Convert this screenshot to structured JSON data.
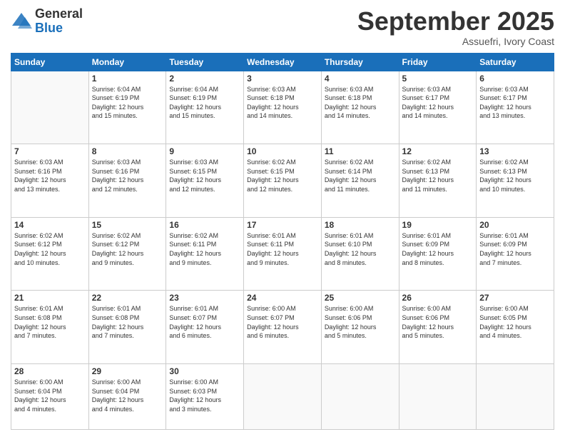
{
  "header": {
    "logo": {
      "general": "General",
      "blue": "Blue"
    },
    "month": "September 2025",
    "location": "Assuefri, Ivory Coast"
  },
  "weekdays": [
    "Sunday",
    "Monday",
    "Tuesday",
    "Wednesday",
    "Thursday",
    "Friday",
    "Saturday"
  ],
  "weeks": [
    [
      {
        "day": "",
        "info": ""
      },
      {
        "day": "1",
        "info": "Sunrise: 6:04 AM\nSunset: 6:19 PM\nDaylight: 12 hours\nand 15 minutes."
      },
      {
        "day": "2",
        "info": "Sunrise: 6:04 AM\nSunset: 6:19 PM\nDaylight: 12 hours\nand 15 minutes."
      },
      {
        "day": "3",
        "info": "Sunrise: 6:03 AM\nSunset: 6:18 PM\nDaylight: 12 hours\nand 14 minutes."
      },
      {
        "day": "4",
        "info": "Sunrise: 6:03 AM\nSunset: 6:18 PM\nDaylight: 12 hours\nand 14 minutes."
      },
      {
        "day": "5",
        "info": "Sunrise: 6:03 AM\nSunset: 6:17 PM\nDaylight: 12 hours\nand 14 minutes."
      },
      {
        "day": "6",
        "info": "Sunrise: 6:03 AM\nSunset: 6:17 PM\nDaylight: 12 hours\nand 13 minutes."
      }
    ],
    [
      {
        "day": "7",
        "info": "Sunrise: 6:03 AM\nSunset: 6:16 PM\nDaylight: 12 hours\nand 13 minutes."
      },
      {
        "day": "8",
        "info": "Sunrise: 6:03 AM\nSunset: 6:16 PM\nDaylight: 12 hours\nand 12 minutes."
      },
      {
        "day": "9",
        "info": "Sunrise: 6:03 AM\nSunset: 6:15 PM\nDaylight: 12 hours\nand 12 minutes."
      },
      {
        "day": "10",
        "info": "Sunrise: 6:02 AM\nSunset: 6:15 PM\nDaylight: 12 hours\nand 12 minutes."
      },
      {
        "day": "11",
        "info": "Sunrise: 6:02 AM\nSunset: 6:14 PM\nDaylight: 12 hours\nand 11 minutes."
      },
      {
        "day": "12",
        "info": "Sunrise: 6:02 AM\nSunset: 6:13 PM\nDaylight: 12 hours\nand 11 minutes."
      },
      {
        "day": "13",
        "info": "Sunrise: 6:02 AM\nSunset: 6:13 PM\nDaylight: 12 hours\nand 10 minutes."
      }
    ],
    [
      {
        "day": "14",
        "info": "Sunrise: 6:02 AM\nSunset: 6:12 PM\nDaylight: 12 hours\nand 10 minutes."
      },
      {
        "day": "15",
        "info": "Sunrise: 6:02 AM\nSunset: 6:12 PM\nDaylight: 12 hours\nand 9 minutes."
      },
      {
        "day": "16",
        "info": "Sunrise: 6:02 AM\nSunset: 6:11 PM\nDaylight: 12 hours\nand 9 minutes."
      },
      {
        "day": "17",
        "info": "Sunrise: 6:01 AM\nSunset: 6:11 PM\nDaylight: 12 hours\nand 9 minutes."
      },
      {
        "day": "18",
        "info": "Sunrise: 6:01 AM\nSunset: 6:10 PM\nDaylight: 12 hours\nand 8 minutes."
      },
      {
        "day": "19",
        "info": "Sunrise: 6:01 AM\nSunset: 6:09 PM\nDaylight: 12 hours\nand 8 minutes."
      },
      {
        "day": "20",
        "info": "Sunrise: 6:01 AM\nSunset: 6:09 PM\nDaylight: 12 hours\nand 7 minutes."
      }
    ],
    [
      {
        "day": "21",
        "info": "Sunrise: 6:01 AM\nSunset: 6:08 PM\nDaylight: 12 hours\nand 7 minutes."
      },
      {
        "day": "22",
        "info": "Sunrise: 6:01 AM\nSunset: 6:08 PM\nDaylight: 12 hours\nand 7 minutes."
      },
      {
        "day": "23",
        "info": "Sunrise: 6:01 AM\nSunset: 6:07 PM\nDaylight: 12 hours\nand 6 minutes."
      },
      {
        "day": "24",
        "info": "Sunrise: 6:00 AM\nSunset: 6:07 PM\nDaylight: 12 hours\nand 6 minutes."
      },
      {
        "day": "25",
        "info": "Sunrise: 6:00 AM\nSunset: 6:06 PM\nDaylight: 12 hours\nand 5 minutes."
      },
      {
        "day": "26",
        "info": "Sunrise: 6:00 AM\nSunset: 6:06 PM\nDaylight: 12 hours\nand 5 minutes."
      },
      {
        "day": "27",
        "info": "Sunrise: 6:00 AM\nSunset: 6:05 PM\nDaylight: 12 hours\nand 4 minutes."
      }
    ],
    [
      {
        "day": "28",
        "info": "Sunrise: 6:00 AM\nSunset: 6:04 PM\nDaylight: 12 hours\nand 4 minutes."
      },
      {
        "day": "29",
        "info": "Sunrise: 6:00 AM\nSunset: 6:04 PM\nDaylight: 12 hours\nand 4 minutes."
      },
      {
        "day": "30",
        "info": "Sunrise: 6:00 AM\nSunset: 6:03 PM\nDaylight: 12 hours\nand 3 minutes."
      },
      {
        "day": "",
        "info": ""
      },
      {
        "day": "",
        "info": ""
      },
      {
        "day": "",
        "info": ""
      },
      {
        "day": "",
        "info": ""
      }
    ]
  ]
}
